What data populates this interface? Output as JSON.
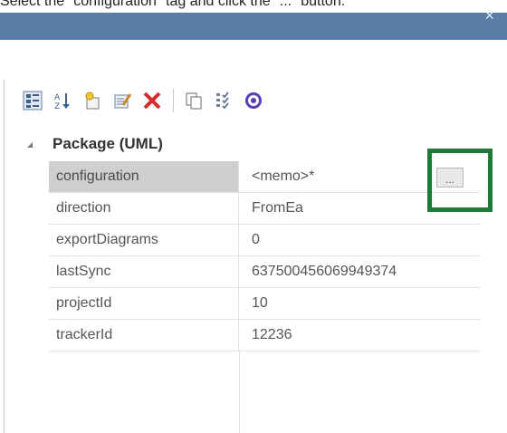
{
  "instruction": "Select the \"configuration\" tag and click the \"...\" button.",
  "window": {
    "close_label": "×"
  },
  "toolbar": {
    "icons": [
      "categorized-view-icon",
      "sort-alphabetical-icon",
      "new-tag-icon",
      "edit-tag-icon",
      "delete-icon",
      "copy-icon",
      "filter-icon",
      "help-icon"
    ]
  },
  "group": {
    "title": "Package (UML)"
  },
  "properties": [
    {
      "name": "configuration",
      "value": "<memo>*"
    },
    {
      "name": "direction",
      "value": "FromEa"
    },
    {
      "name": "exportDiagrams",
      "value": "0"
    },
    {
      "name": "lastSync",
      "value": "637500456069949374"
    },
    {
      "name": "projectId",
      "value": "10"
    },
    {
      "name": "trackerId",
      "value": "12236"
    }
  ],
  "ellipsis_button": {
    "label": "..."
  },
  "colors": {
    "title_bar": "#5a7ea8",
    "highlight": "#1e7a34",
    "selected_row": "#cfcfcf",
    "delete_icon": "#d62b2b",
    "help_icon": "#5b3fb0"
  }
}
